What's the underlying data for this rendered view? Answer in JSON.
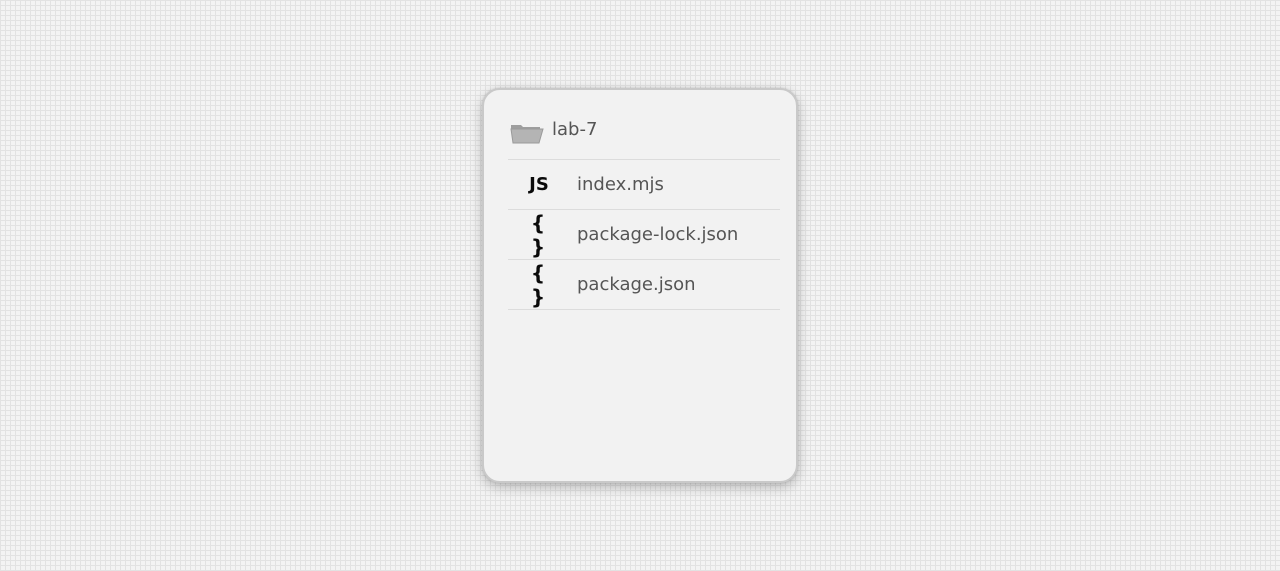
{
  "folder": {
    "name": "lab-7",
    "icon": "folder-icon"
  },
  "files": [
    {
      "name": "index.mjs",
      "icon_text": "JS",
      "icon": "javascript-file-icon"
    },
    {
      "name": "package-lock.json",
      "icon_text": "{ }",
      "icon": "json-file-icon"
    },
    {
      "name": "package.json",
      "icon_text": "{ }",
      "icon": "json-file-icon"
    }
  ],
  "colors": {
    "text": "#555555",
    "icon": "#0a0a0a",
    "folder": "#a8a8a8",
    "panel_bg": "#f2f2f2"
  }
}
